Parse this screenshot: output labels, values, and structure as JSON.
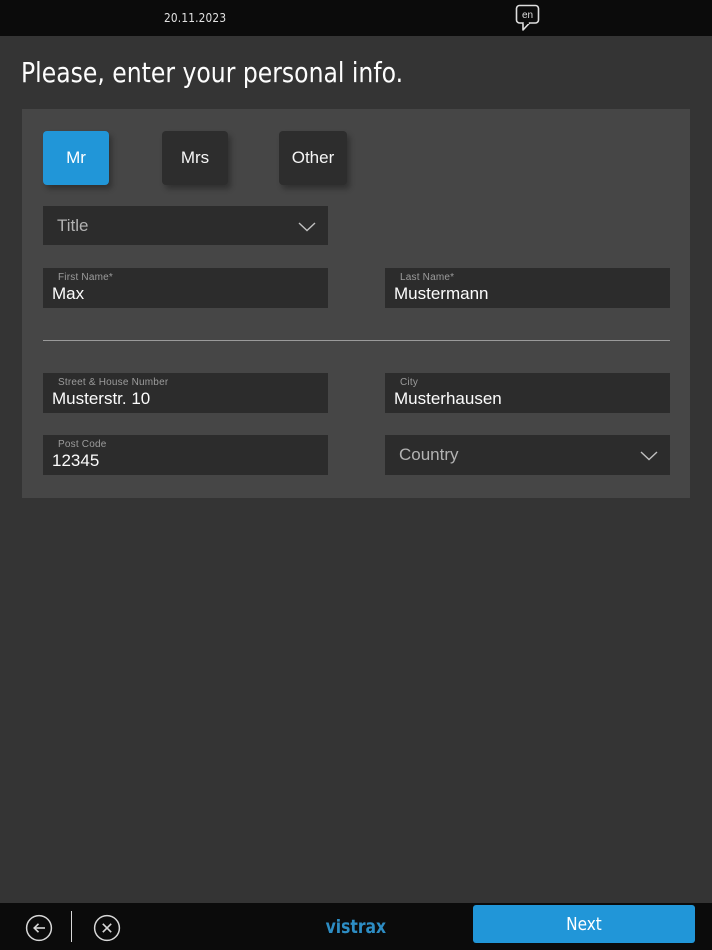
{
  "topbar": {
    "date": "20.11.2023",
    "language_code": "en"
  },
  "heading": {
    "title": "Please, enter your personal info."
  },
  "form": {
    "salutation_options": [
      {
        "label": "Mr",
        "selected": true
      },
      {
        "label": "Mrs",
        "selected": false
      },
      {
        "label": "Other",
        "selected": false
      }
    ],
    "title_dropdown": {
      "placeholder": "Title"
    },
    "first_name": {
      "label": "First Name*",
      "value": "Max"
    },
    "last_name": {
      "label": "Last Name*",
      "value": "Mustermann"
    },
    "street": {
      "label": "Street & House Number",
      "value": "Musterstr. 10"
    },
    "city": {
      "label": "City",
      "value": "Musterhausen"
    },
    "post_code": {
      "label": "Post Code",
      "value": "12345"
    },
    "country_dropdown": {
      "placeholder": "Country"
    }
  },
  "footer": {
    "brand": "vistrax",
    "next_label": "Next"
  },
  "colors": {
    "accent_blue": "#2196d8",
    "brand_blue": "#2d8dc4",
    "page_bg": "#343434",
    "card_bg": "#464646",
    "field_bg": "#2c2c2c",
    "bar_bg": "#0b0b0b"
  }
}
